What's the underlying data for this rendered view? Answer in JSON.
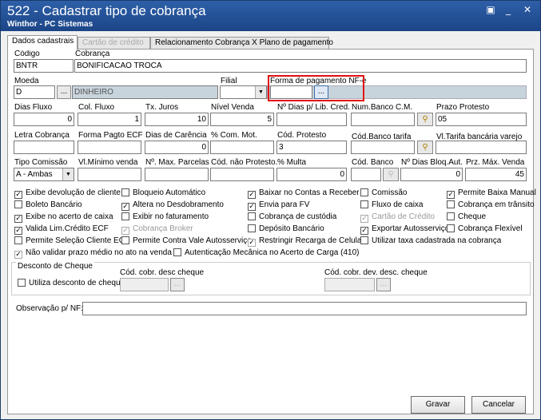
{
  "window": {
    "title": "522 - Cadastrar tipo de cobrança",
    "subtitle": "Winthor - PC Sistemas",
    "controls": {
      "minimize": "_",
      "restore": "▣",
      "close": "✕"
    }
  },
  "tabs": [
    {
      "label": "Dados cadastrais"
    },
    {
      "label": "Cartão de crédito"
    },
    {
      "label": "Relacionamento Cobrança X Plano de pagamento"
    }
  ],
  "fields": {
    "codigo": {
      "label": "Código",
      "value": "BNTR"
    },
    "cobranca": {
      "label": "Cobrança",
      "value": "BONIFICACAO TROCA"
    },
    "moeda": {
      "label": "Moeda",
      "code": "D",
      "button": "...",
      "name": "DINHEIRO"
    },
    "filial": {
      "label": "Filial",
      "value": ""
    },
    "forma_pagamento": {
      "label": "Forma de pagamento NF-e",
      "value": "",
      "button": "...",
      "desc": ""
    },
    "dias_fluxo": {
      "label": "Dias Fluxo",
      "value": "0"
    },
    "col_fluxo": {
      "label": "Col. Fluxo",
      "value": "1"
    },
    "tx_juros": {
      "label": "Tx. Juros",
      "value": "10"
    },
    "nivel_venda": {
      "label": "Nível Venda",
      "value": "5"
    },
    "dias_lib_cred": {
      "label": "Nº Dias p/ Lib. Cred.",
      "value": ""
    },
    "num_banco_cm": {
      "label": "Num.Banco C.M.",
      "value": ""
    },
    "prazo_protesto": {
      "label": "Prazo Protesto",
      "value": "05"
    },
    "letra_cobranca": {
      "label": "Letra Cobrança",
      "value": ""
    },
    "forma_pagto_ecf": {
      "label": "Forma Pagto ECF",
      "value": ""
    },
    "dias_carencia": {
      "label": "Dias de Carência",
      "value": "0"
    },
    "com_mot": {
      "label": "% Com. Mot.",
      "value": ""
    },
    "cod_protesto": {
      "label": "Cód. Protesto",
      "value": "3"
    },
    "cod_banco_tarifa": {
      "label": "Cód.Banco tarifa",
      "value": ""
    },
    "vl_tarifa": {
      "label": "Vl.Tarifa bancária varejo",
      "value": ""
    },
    "tipo_comissao": {
      "label": "Tipo Comissão",
      "value": "A - Ambas"
    },
    "vl_minimo_venda": {
      "label": "Vl.Mínimo venda",
      "value": ""
    },
    "max_parcelas": {
      "label": "Nº. Max. Parcelas",
      "value": ""
    },
    "cod_nao_protesto": {
      "label": "Cód. não Protesto.",
      "value": ""
    },
    "multa": {
      "label": "% Multa",
      "value": "0"
    },
    "cod_banco": {
      "label": "Cód. Banco",
      "value": ""
    },
    "dias_bloq_aut": {
      "label": "Nº Dias Bloq.Aut.",
      "value": "0"
    },
    "prz_max_venda": {
      "label": "Prz. Máx. Venda",
      "value": "45"
    }
  },
  "checkboxes": [
    {
      "label": "Exibe devolução de cliente",
      "checked": true
    },
    {
      "label": "Bloqueio Automático",
      "checked": false
    },
    {
      "label": "Baixar no Contas a Receber",
      "checked": true
    },
    {
      "label": "Comissão",
      "checked": false
    },
    {
      "label": "Permite Baixa Manual",
      "checked": true
    },
    {
      "label": "Boleto Bancário",
      "checked": false
    },
    {
      "label": "Altera no Desdobramento",
      "checked": true
    },
    {
      "label": "Envia para FV",
      "checked": true
    },
    {
      "label": "Fluxo de caixa",
      "checked": false
    },
    {
      "label": "Cobrança em trânsito",
      "checked": false
    },
    {
      "label": "Exibe no acerto de caixa",
      "checked": true
    },
    {
      "label": "Exibir no faturamento",
      "checked": false
    },
    {
      "label": "Cobrança de custódia",
      "checked": false
    },
    {
      "label": "Cartão de Crédito",
      "checked": true,
      "disabled": true
    },
    {
      "label": "Cheque",
      "checked": false
    },
    {
      "label": "Valida Lim.Crédito ECF",
      "checked": true
    },
    {
      "label": "Cobrança Broker",
      "checked": true,
      "disabled": true
    },
    {
      "label": "Depósito Bancário",
      "checked": false
    },
    {
      "label": "Exportar Autosserviço",
      "checked": true
    },
    {
      "label": "Cobrança Flexível",
      "checked": false
    },
    {
      "label": "Permite Seleção Cliente ECF",
      "checked": false
    },
    {
      "label": "Permite Contra Vale Autosserviço",
      "checked": false
    },
    {
      "label": "Restringir Recarga de Celular",
      "checked": true,
      "disabled": true
    },
    {
      "label": "Utilizar taxa cadastrada na cobrança",
      "checked": false
    },
    {
      "label": "Não validar prazo médio no ato na venda",
      "checked": true,
      "disabled": true
    },
    {
      "label": "Autenticação Mecânica no Acerto de Carga (410)",
      "checked": false
    }
  ],
  "desconto_cheque": {
    "title": "Desconto de Cheque",
    "utiliza": {
      "label": "Utiliza desconto de cheque",
      "checked": false
    },
    "cod_cobr_desc": {
      "label": "Cód. cobr. desc cheque",
      "value": "",
      "button": "..."
    },
    "cod_cobr_dev_desc": {
      "label": "Cód. cobr. dev. desc. cheque",
      "value": "",
      "button": "..."
    }
  },
  "observacao": {
    "label": "Observação p/ NF:",
    "value": ""
  },
  "buttons": {
    "gravar": "Gravar",
    "cancelar": "Cancelar"
  },
  "colors": {
    "title_bg": "#1c4587",
    "highlight": "#e01010",
    "disabled_field": "#c8d4dc"
  }
}
